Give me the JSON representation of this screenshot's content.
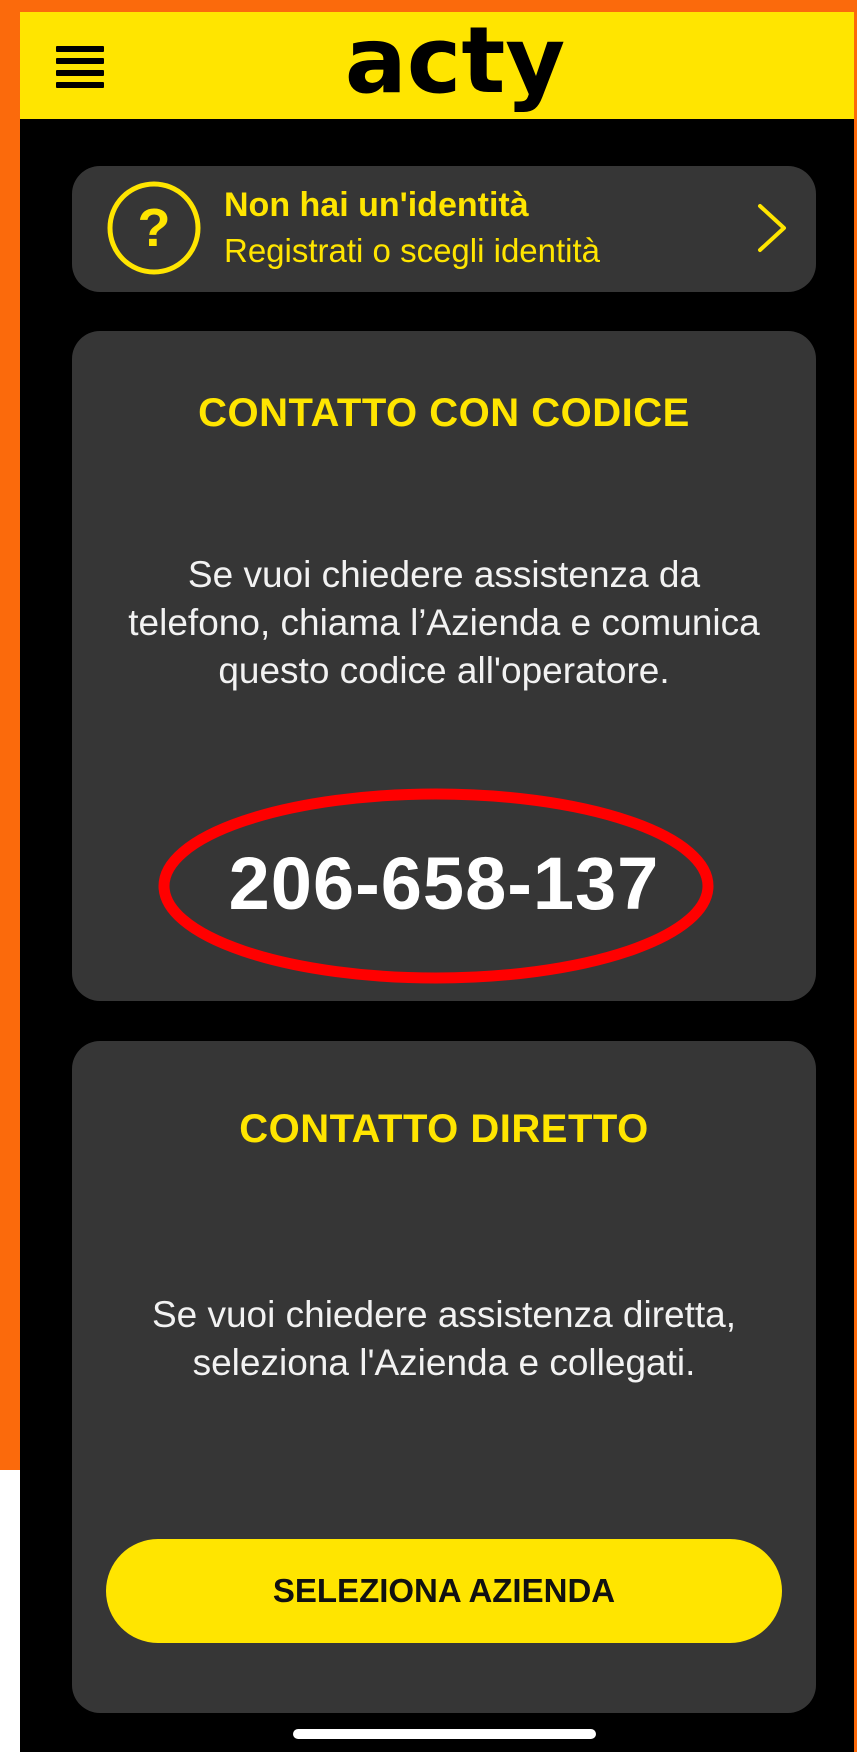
{
  "header": {
    "logo_text": "acty",
    "menu_icon": "hamburger-menu-icon",
    "background": "#ffe500"
  },
  "identity": {
    "icon": "question-circle-icon",
    "title": "Non hai un'identità",
    "subtitle": "Registrati o scegli identità",
    "chevron_icon": "chevron-right-icon"
  },
  "code_contact": {
    "title": "CONTATTO CON CODICE",
    "description": "Se vuoi chiedere assistenza da telefono, chiama l’Azienda e comunica questo codice all'operatore.",
    "code": "206-658-137"
  },
  "direct_contact": {
    "title": "CONTATTO DIRETTO",
    "description": "Se vuoi chiedere assistenza diretta, seleziona l'Azienda e collegati.",
    "button_label": "SELEZIONA AZIENDA"
  },
  "colors": {
    "accent": "#ffe500",
    "card": "#363636",
    "background": "#000000",
    "highlight": "#ff0000",
    "frame": "#fb6a0c"
  }
}
